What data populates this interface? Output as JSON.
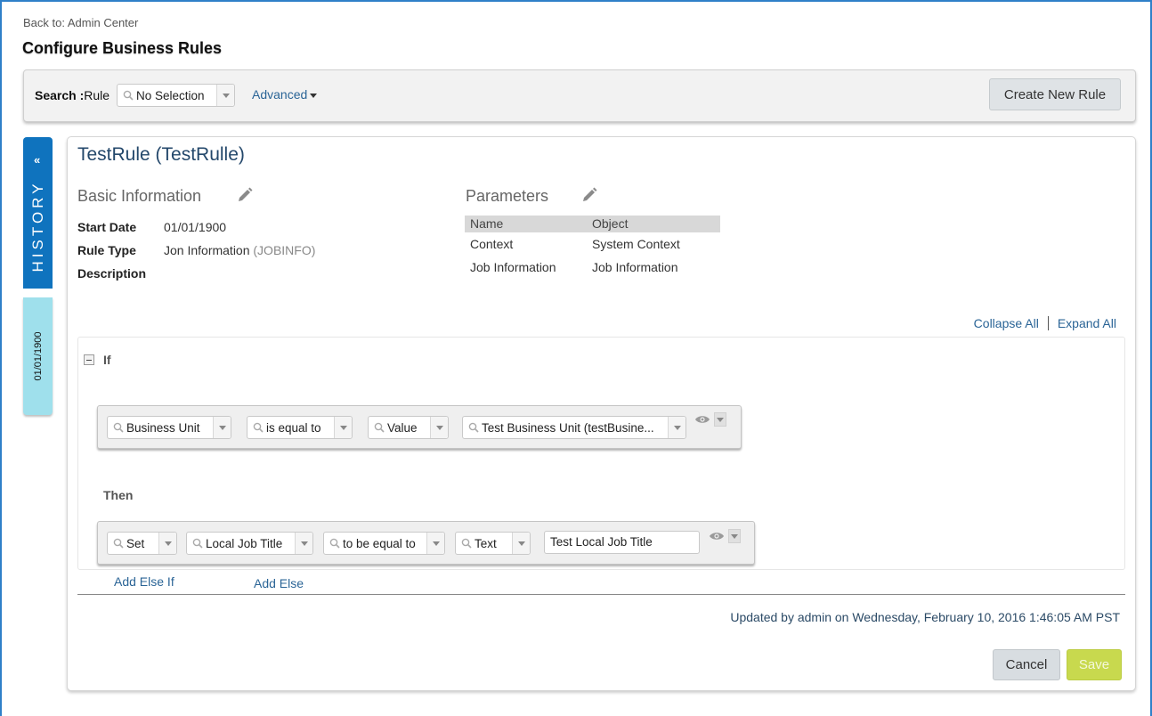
{
  "header": {
    "back_prefix": "Back to:",
    "back_link": "Admin Center",
    "page_title": "Configure Business Rules"
  },
  "search": {
    "label_bold": "Search :",
    "label_field": "Rule",
    "selection": "No Selection",
    "advanced": "Advanced",
    "create_button": "Create New Rule"
  },
  "history": {
    "tab_label": "HISTORY",
    "chevron": "«",
    "date": "01/01/1900"
  },
  "rule": {
    "title": "TestRule (TestRulle)",
    "basic_info_title": "Basic Information",
    "start_date_label": "Start Date",
    "start_date_value": "01/01/1900",
    "rule_type_label": "Rule Type",
    "rule_type_value": "Jon Information",
    "rule_type_code": "(JOBINFO)",
    "description_label": "Description"
  },
  "parameters": {
    "title": "Parameters",
    "headers": [
      "Name",
      "Object"
    ],
    "rows": [
      [
        "Context",
        "System Context"
      ],
      [
        "Job Information",
        "Job Information"
      ]
    ]
  },
  "toggles": {
    "collapse_all": "Collapse All",
    "expand_all": "Expand All"
  },
  "if_block": {
    "label": "If",
    "field": "Business Unit",
    "operator": "is equal to",
    "value_type": "Value",
    "value": "Test Business Unit (testBusine..."
  },
  "then_block": {
    "label": "Then",
    "action": "Set",
    "field": "Local Job Title",
    "operator": "to be equal to",
    "value_type": "Text",
    "value": "Test Local Job Title"
  },
  "footer": {
    "add_else_if": "Add Else If",
    "add_else": "Add Else",
    "updated_text": "Updated by admin on Wednesday, February 10, 2016 1:46:05 AM PST",
    "cancel": "Cancel",
    "save": "Save"
  },
  "colors": {
    "accent_blue": "#0f73be",
    "history_date_bg": "#9fe0ec",
    "link": "#2a6496",
    "save_bg": "#c8d94e"
  }
}
